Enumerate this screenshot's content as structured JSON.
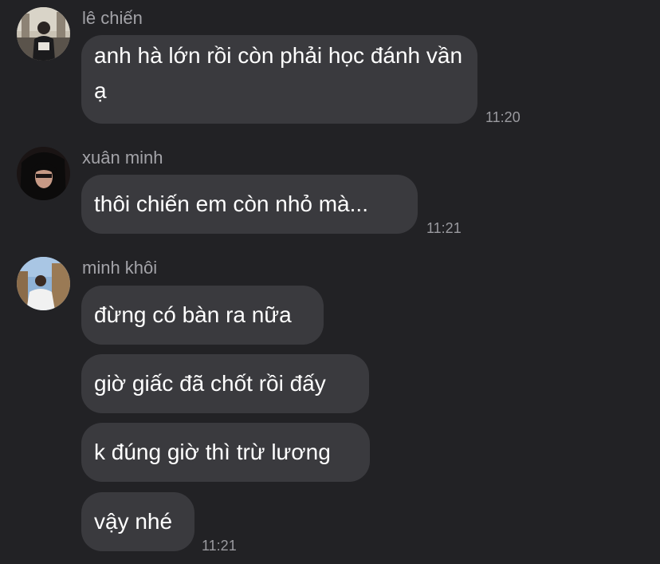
{
  "messages": [
    {
      "sender": "lê chiến",
      "avatar_icon": "avatar-photo-le-chien",
      "bubbles": [
        "anh hà lớn rồi còn phải học đánh vần ạ"
      ],
      "time": "11:20"
    },
    {
      "sender": "xuân minh",
      "avatar_icon": "avatar-photo-xuan-minh",
      "bubbles": [
        "thôi chiến em còn nhỏ mà..."
      ],
      "time": "11:21"
    },
    {
      "sender": "minh khôi",
      "avatar_icon": "avatar-photo-minh-khoi",
      "bubbles": [
        "đừng có bàn ra nữa",
        "giờ giấc đã chốt rồi đấy",
        "k đúng giờ thì trừ lương",
        "vậy nhé"
      ],
      "time": "11:21"
    }
  ],
  "colors": {
    "background": "#222225",
    "bubble": "#3a3a3e",
    "sender_name": "#a3a3a8",
    "timestamp": "#9a9a9f",
    "text": "#ffffff"
  }
}
